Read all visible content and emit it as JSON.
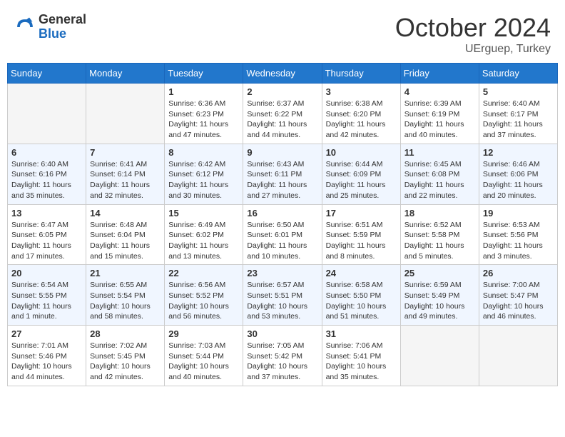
{
  "header": {
    "logo_general": "General",
    "logo_blue": "Blue",
    "month_year": "October 2024",
    "location": "UErguep, Turkey"
  },
  "days_of_week": [
    "Sunday",
    "Monday",
    "Tuesday",
    "Wednesday",
    "Thursday",
    "Friday",
    "Saturday"
  ],
  "weeks": [
    [
      {
        "day": "",
        "info": ""
      },
      {
        "day": "",
        "info": ""
      },
      {
        "day": "1",
        "info": "Sunrise: 6:36 AM\nSunset: 6:23 PM\nDaylight: 11 hours and 47 minutes."
      },
      {
        "day": "2",
        "info": "Sunrise: 6:37 AM\nSunset: 6:22 PM\nDaylight: 11 hours and 44 minutes."
      },
      {
        "day": "3",
        "info": "Sunrise: 6:38 AM\nSunset: 6:20 PM\nDaylight: 11 hours and 42 minutes."
      },
      {
        "day": "4",
        "info": "Sunrise: 6:39 AM\nSunset: 6:19 PM\nDaylight: 11 hours and 40 minutes."
      },
      {
        "day": "5",
        "info": "Sunrise: 6:40 AM\nSunset: 6:17 PM\nDaylight: 11 hours and 37 minutes."
      }
    ],
    [
      {
        "day": "6",
        "info": "Sunrise: 6:40 AM\nSunset: 6:16 PM\nDaylight: 11 hours and 35 minutes."
      },
      {
        "day": "7",
        "info": "Sunrise: 6:41 AM\nSunset: 6:14 PM\nDaylight: 11 hours and 32 minutes."
      },
      {
        "day": "8",
        "info": "Sunrise: 6:42 AM\nSunset: 6:12 PM\nDaylight: 11 hours and 30 minutes."
      },
      {
        "day": "9",
        "info": "Sunrise: 6:43 AM\nSunset: 6:11 PM\nDaylight: 11 hours and 27 minutes."
      },
      {
        "day": "10",
        "info": "Sunrise: 6:44 AM\nSunset: 6:09 PM\nDaylight: 11 hours and 25 minutes."
      },
      {
        "day": "11",
        "info": "Sunrise: 6:45 AM\nSunset: 6:08 PM\nDaylight: 11 hours and 22 minutes."
      },
      {
        "day": "12",
        "info": "Sunrise: 6:46 AM\nSunset: 6:06 PM\nDaylight: 11 hours and 20 minutes."
      }
    ],
    [
      {
        "day": "13",
        "info": "Sunrise: 6:47 AM\nSunset: 6:05 PM\nDaylight: 11 hours and 17 minutes."
      },
      {
        "day": "14",
        "info": "Sunrise: 6:48 AM\nSunset: 6:04 PM\nDaylight: 11 hours and 15 minutes."
      },
      {
        "day": "15",
        "info": "Sunrise: 6:49 AM\nSunset: 6:02 PM\nDaylight: 11 hours and 13 minutes."
      },
      {
        "day": "16",
        "info": "Sunrise: 6:50 AM\nSunset: 6:01 PM\nDaylight: 11 hours and 10 minutes."
      },
      {
        "day": "17",
        "info": "Sunrise: 6:51 AM\nSunset: 5:59 PM\nDaylight: 11 hours and 8 minutes."
      },
      {
        "day": "18",
        "info": "Sunrise: 6:52 AM\nSunset: 5:58 PM\nDaylight: 11 hours and 5 minutes."
      },
      {
        "day": "19",
        "info": "Sunrise: 6:53 AM\nSunset: 5:56 PM\nDaylight: 11 hours and 3 minutes."
      }
    ],
    [
      {
        "day": "20",
        "info": "Sunrise: 6:54 AM\nSunset: 5:55 PM\nDaylight: 11 hours and 1 minute."
      },
      {
        "day": "21",
        "info": "Sunrise: 6:55 AM\nSunset: 5:54 PM\nDaylight: 10 hours and 58 minutes."
      },
      {
        "day": "22",
        "info": "Sunrise: 6:56 AM\nSunset: 5:52 PM\nDaylight: 10 hours and 56 minutes."
      },
      {
        "day": "23",
        "info": "Sunrise: 6:57 AM\nSunset: 5:51 PM\nDaylight: 10 hours and 53 minutes."
      },
      {
        "day": "24",
        "info": "Sunrise: 6:58 AM\nSunset: 5:50 PM\nDaylight: 10 hours and 51 minutes."
      },
      {
        "day": "25",
        "info": "Sunrise: 6:59 AM\nSunset: 5:49 PM\nDaylight: 10 hours and 49 minutes."
      },
      {
        "day": "26",
        "info": "Sunrise: 7:00 AM\nSunset: 5:47 PM\nDaylight: 10 hours and 46 minutes."
      }
    ],
    [
      {
        "day": "27",
        "info": "Sunrise: 7:01 AM\nSunset: 5:46 PM\nDaylight: 10 hours and 44 minutes."
      },
      {
        "day": "28",
        "info": "Sunrise: 7:02 AM\nSunset: 5:45 PM\nDaylight: 10 hours and 42 minutes."
      },
      {
        "day": "29",
        "info": "Sunrise: 7:03 AM\nSunset: 5:44 PM\nDaylight: 10 hours and 40 minutes."
      },
      {
        "day": "30",
        "info": "Sunrise: 7:05 AM\nSunset: 5:42 PM\nDaylight: 10 hours and 37 minutes."
      },
      {
        "day": "31",
        "info": "Sunrise: 7:06 AM\nSunset: 5:41 PM\nDaylight: 10 hours and 35 minutes."
      },
      {
        "day": "",
        "info": ""
      },
      {
        "day": "",
        "info": ""
      }
    ]
  ]
}
